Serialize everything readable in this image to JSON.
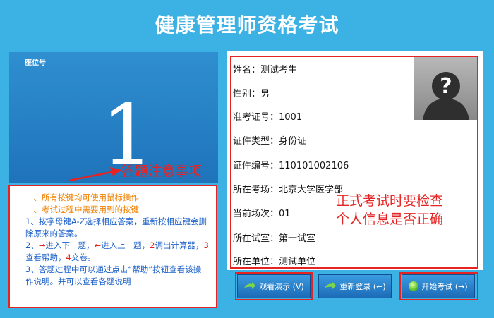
{
  "header": {
    "title": "健康管理师资格考试"
  },
  "seat": {
    "label": "座位号",
    "number": "1"
  },
  "annotations": {
    "notice_caption": "答题注意事项",
    "info_caption_1": "正式考试时要检查",
    "info_caption_2": "个人信息是否正确"
  },
  "notice": {
    "line1": "一、所有按键均可使用鼠标操作",
    "line2": "二、考试过程中需要用到的按键",
    "line3": "1、按字母键A-Z选择相应答案，重新按相应键会删除原来的答案。",
    "line4_a": "2、",
    "line4_b": "→",
    "line4_c": "进入下一题，",
    "line4_d": "←",
    "line4_e": "进入上一题，",
    "line4_f": "2",
    "line4_g": "调出计算器，",
    "line4_h": "3",
    "line4_i": "查看帮助，",
    "line4_j": "4",
    "line4_k": "交卷。",
    "line5": "3、答题过程中可以通过点击“帮助”按钮查看该操作说明。并可以查看各题说明"
  },
  "info": {
    "name": "姓名：测试考生",
    "gender": "性别：男",
    "ticket": "准考证号：1001",
    "id_type": "证件类型：身份证",
    "id_number": "证件编号：110101002106",
    "site": "所在考场：北京大学医学部",
    "session": "当前场次：01",
    "room": "所在试室：第一试室",
    "unit": "所在单位：测试单位"
  },
  "buttons": {
    "demo": "观看演示 (V)",
    "relogin": "重新登录 (←)",
    "start": "开始考试 (→)"
  },
  "icons": {
    "photo": "person-placeholder-icon",
    "arrow": "right-arrow-icon",
    "start": "green-circle-icon"
  }
}
